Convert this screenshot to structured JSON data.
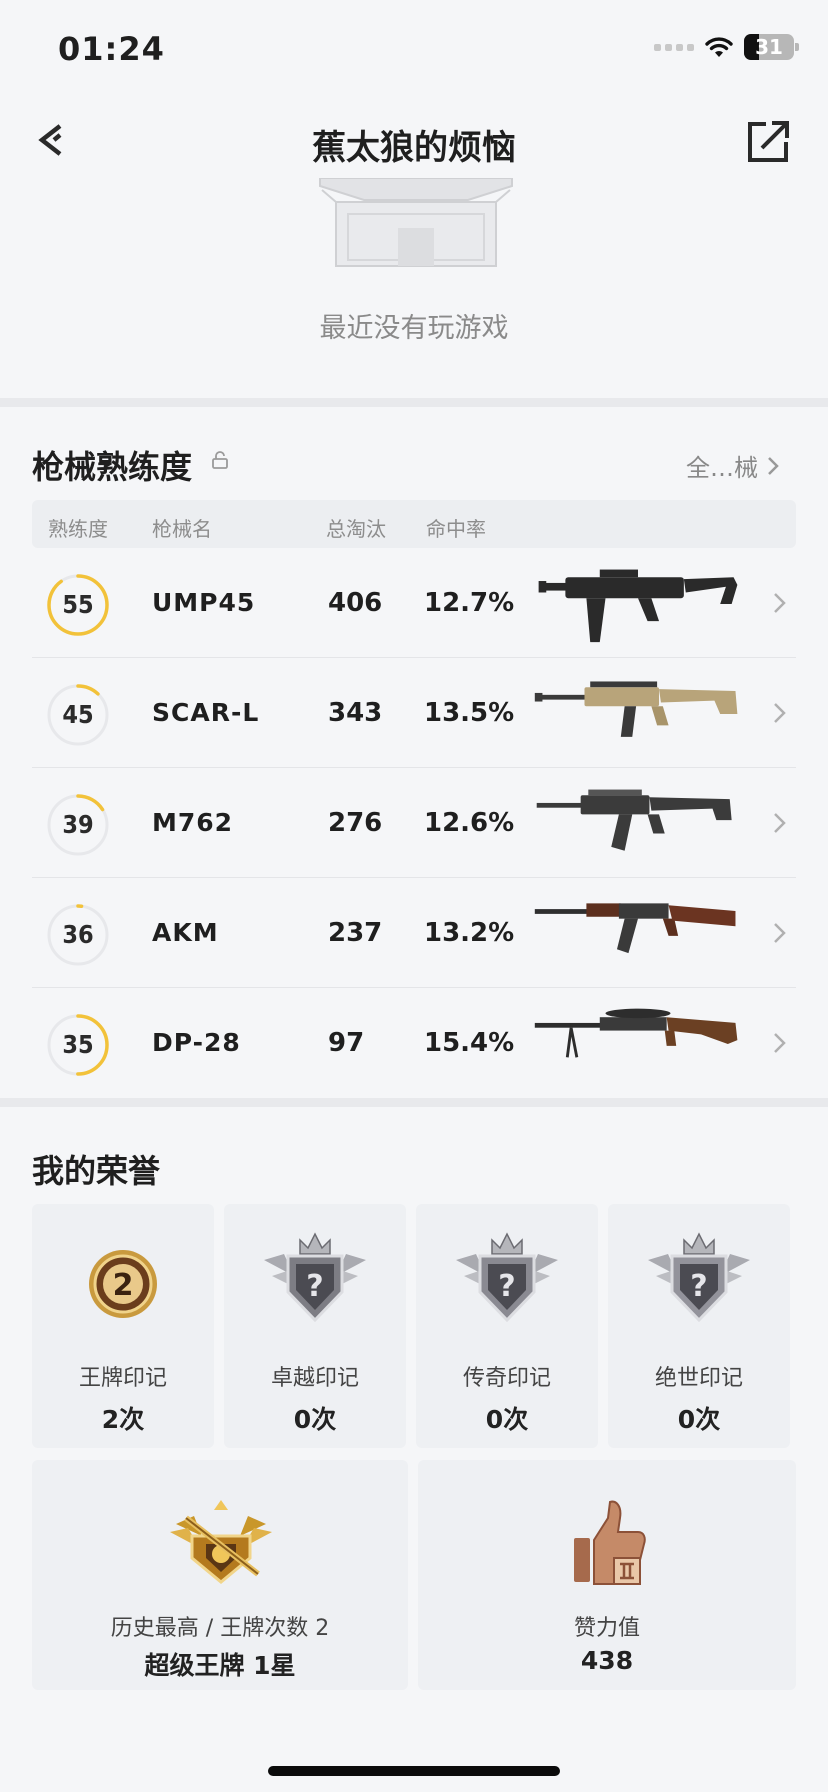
{
  "status_bar": {
    "time": "01:24",
    "battery": "31"
  },
  "nav": {
    "title": "蕉太狼的烦恼"
  },
  "empty_state": {
    "text": "最近没有玩游戏"
  },
  "weapons": {
    "title": "枪械熟练度",
    "all_link": "全…械",
    "headers": {
      "proficiency": "熟练度",
      "name": "枪械名",
      "kills": "总淘汰",
      "accuracy": "命中率"
    },
    "rows": [
      {
        "level": "55",
        "progress": 0.9,
        "name": "UMP45",
        "kills": "406",
        "accuracy": "12.7%",
        "gun": "smg"
      },
      {
        "level": "45",
        "progress": 0.12,
        "name": "SCAR-L",
        "kills": "343",
        "accuracy": "13.5%",
        "gun": "rifle-tan"
      },
      {
        "level": "39",
        "progress": 0.16,
        "name": "M762",
        "kills": "276",
        "accuracy": "12.6%",
        "gun": "rifle-dark"
      },
      {
        "level": "36",
        "progress": 0.02,
        "name": "AKM",
        "kills": "237",
        "accuracy": "13.2%",
        "gun": "rifle-wood"
      },
      {
        "level": "35",
        "progress": 0.5,
        "name": "DP-28",
        "kills": "97",
        "accuracy": "15.4%",
        "gun": "lmg"
      }
    ]
  },
  "honors": {
    "title": "我的荣誉",
    "marks": [
      {
        "label": "王牌印记",
        "value": "2次",
        "badge_text": "2",
        "icon": "ace-mark-icon"
      },
      {
        "label": "卓越印记",
        "value": "0次",
        "icon": "excellence-mark-icon"
      },
      {
        "label": "传奇印记",
        "value": "0次",
        "icon": "legend-mark-icon"
      },
      {
        "label": "绝世印记",
        "value": "0次",
        "icon": "peerless-mark-icon"
      }
    ],
    "best": {
      "label": "历史最高 / 王牌次数 2",
      "value": "超级王牌 1星",
      "icon": "super-ace-tier-icon"
    },
    "likes": {
      "label": "赞力值",
      "value": "438",
      "icon": "thumbs-up-icon"
    }
  }
}
